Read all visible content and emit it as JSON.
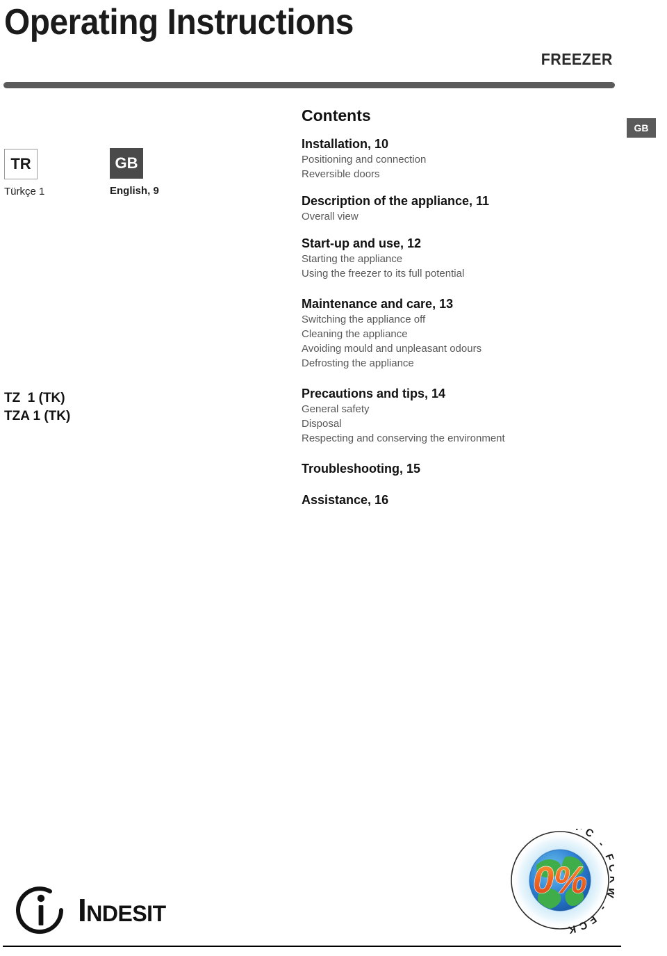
{
  "header": {
    "title": "Operating Instructions",
    "appliance_type": "FREEZER"
  },
  "languages": [
    {
      "code": "TR",
      "caption": "Türkçe 1",
      "style": "outline"
    },
    {
      "code": "GB",
      "caption": "English, 9",
      "style": "filled"
    }
  ],
  "edge_tab": {
    "label": "GB"
  },
  "models": {
    "lines": "TZ  1 (TK)\nTZA 1 (TK)"
  },
  "contents": {
    "heading": "Contents",
    "sections": [
      {
        "title": "Installation, 10",
        "items": [
          "Positioning and connection",
          "Reversible doors"
        ]
      },
      {
        "title": "Description of the appliance, 11",
        "items": [
          "Overall view"
        ]
      },
      {
        "title": "Start-up and use, 12",
        "items": [
          "Starting the appliance",
          "Using the freezer to its full potential"
        ]
      },
      {
        "title": "Maintenance and care, 13",
        "items": [
          "Switching the appliance off",
          "Cleaning the appliance",
          "Avoiding mould and unpleasant odours",
          "Defrosting the appliance"
        ]
      },
      {
        "title": "Precautions and tips, 14",
        "items": [
          "General safety",
          "Disposal",
          "Respecting and conserving the environment"
        ]
      },
      {
        "title": "Troubleshooting, 15",
        "items": []
      },
      {
        "title": "Assistance, 16",
        "items": []
      }
    ]
  },
  "brand": {
    "name": "Indesit",
    "logo_icon": "indesit-circle-i-icon"
  },
  "eco_badge": {
    "ring_text": "CFC - FCKW - FCK",
    "center_text": "0%",
    "icon": "globe-eco-icon",
    "colors": {
      "globe_blue": "#2b7fd4",
      "globe_green": "#3fae4a",
      "percent_orange": "#f26a21",
      "ring_stroke": "#1a1a1a"
    }
  },
  "colors": {
    "rule_gray": "#5b5b5b",
    "badge_gray": "#4a4a4a",
    "sub_text_gray": "#585858",
    "title_black": "#1b1b1b"
  }
}
